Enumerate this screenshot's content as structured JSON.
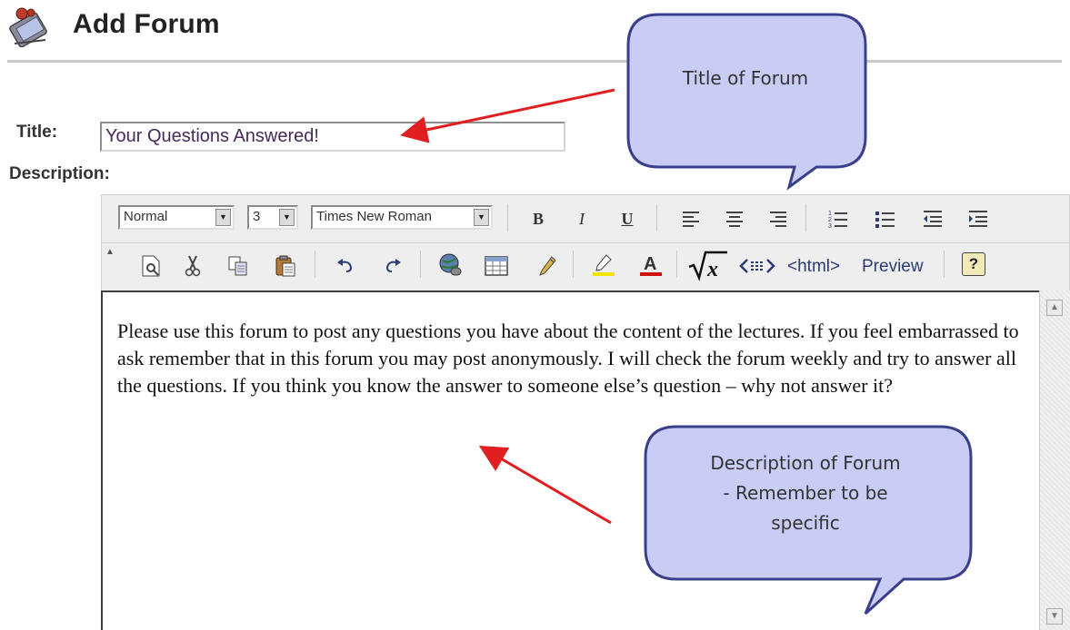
{
  "header": {
    "title": "Add Forum",
    "icon": "forum-icon"
  },
  "form": {
    "title_label": "Title:",
    "title_value": "Your Questions Answered!",
    "description_label": "Description:"
  },
  "toolbar": {
    "style_select": "Normal",
    "size_select": "3",
    "font_select": "Times New Roman",
    "bold": "B",
    "italic": "I",
    "underline": "U",
    "html_label": "<html>",
    "preview_label": "Preview",
    "help_label": "?",
    "icons_row1": [
      "bold-icon",
      "italic-icon",
      "underline-icon",
      "align-left-icon",
      "align-center-icon",
      "align-right-icon",
      "ordered-list-icon",
      "unordered-list-icon",
      "outdent-icon",
      "indent-icon"
    ],
    "icons_row2": [
      "preview-page-icon",
      "cut-icon",
      "copy-icon",
      "paste-icon",
      "undo-icon",
      "redo-icon",
      "insert-link-icon",
      "insert-table-icon",
      "pencil-icon",
      "highlight-color-icon",
      "font-color-icon",
      "equation-icon",
      "embed-code-icon",
      "help-icon"
    ]
  },
  "editor": {
    "content": "Please use this forum to post any questions you have about the content of the lectures.  If you feel embarrassed to ask remember that in this forum you may post anonymously.  I will check the forum weekly and try to answer all the questions.  If you think you know the answer to someone else’s question – why not answer it?"
  },
  "annotations": {
    "title_callout": "Title of Forum",
    "description_callout": [
      "Description of Forum",
      "- Remember to be",
      "specific"
    ],
    "arrow_color": "#e02020",
    "callout_fill": "#c9cdf5",
    "callout_stroke": "#3a3f8c"
  }
}
